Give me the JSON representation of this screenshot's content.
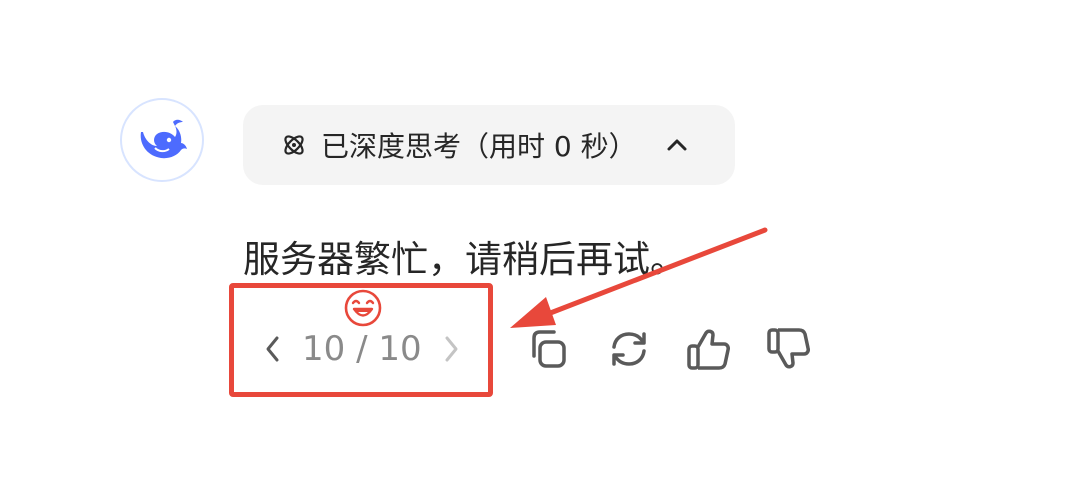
{
  "assistant": {
    "avatar_icon": "deepseek-whale-icon",
    "brand_color": "#4d6bfe"
  },
  "thinking": {
    "label": "已深度思考（用时 0 秒）",
    "icon": "atom-icon",
    "toggle_icon": "chevron-up-icon"
  },
  "answer": {
    "text": "服务器繁忙，请稍后再试。"
  },
  "pager": {
    "count": "10 / 10",
    "prev_icon": "chevron-left-icon",
    "next_icon": "chevron-right-icon"
  },
  "actions": {
    "icons": [
      "copy-icon",
      "regenerate-icon",
      "thumbs-up-icon",
      "thumbs-down-icon"
    ]
  },
  "annotation": {
    "color": "#e8483b",
    "emoji_icon": "grinning-face-icon"
  }
}
